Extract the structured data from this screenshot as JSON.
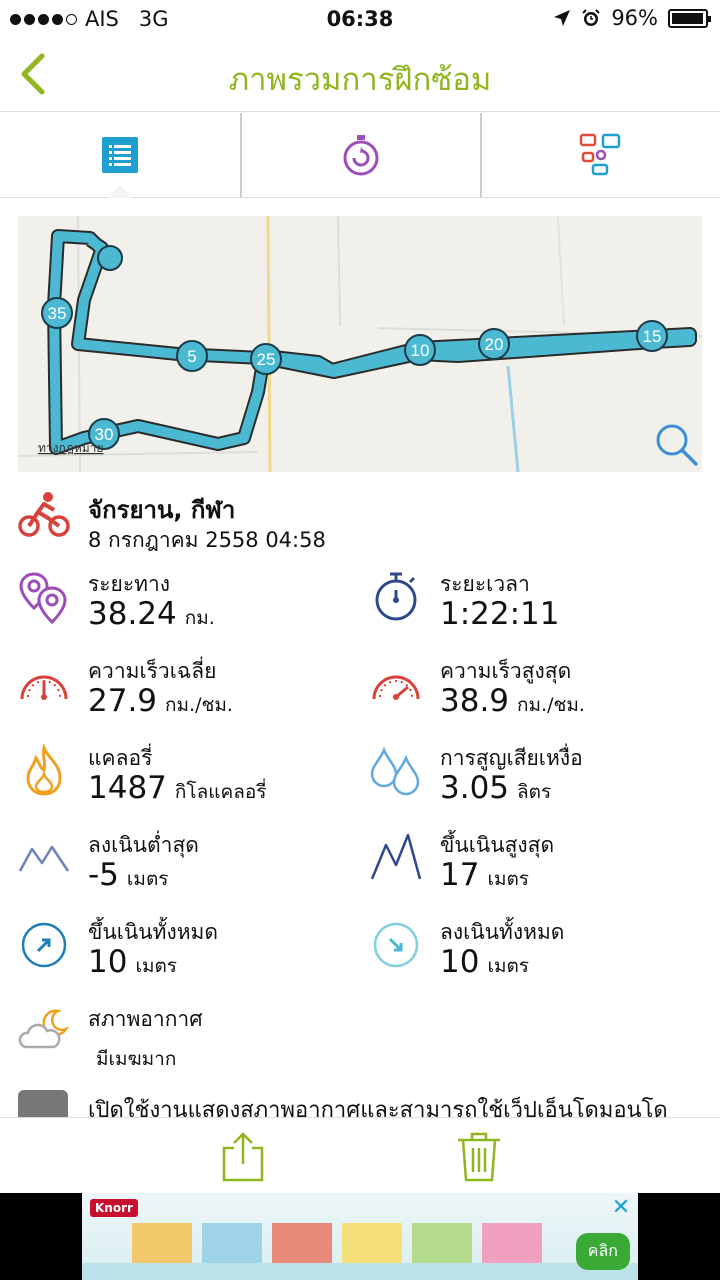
{
  "status_bar": {
    "carrier": "AIS",
    "network": "3G",
    "time": "06:38",
    "battery": "96%"
  },
  "header": {
    "title": "ภาพรวมการฝึกซ้อม"
  },
  "tabs": [
    {
      "name": "summary",
      "icon": "list-icon",
      "active": true
    },
    {
      "name": "laps",
      "icon": "stopwatch-icon",
      "active": false
    },
    {
      "name": "share",
      "icon": "social-icon",
      "active": false
    }
  ],
  "map": {
    "markers": [
      "35",
      "5",
      "25",
      "10",
      "20",
      "15",
      "30"
    ],
    "attribution": "ทางกฎหมาย"
  },
  "activity": {
    "type": "จักรยาน, กีฬา",
    "date": "8 กรกฎาคม 2558 04:58"
  },
  "stats": {
    "distance": {
      "label": "ระยะทาง",
      "value": "38.24",
      "unit": "กม."
    },
    "duration": {
      "label": "ระยะเวลา",
      "value": "1:22:11"
    },
    "avg_speed": {
      "label": "ความเร็วเฉลี่ย",
      "value": "27.9",
      "unit": "กม./ชม."
    },
    "max_speed": {
      "label": "ความเร็วสูงสุด",
      "value": "38.9",
      "unit": "กม./ชม."
    },
    "calories": {
      "label": "แคลอรี่",
      "value": "1487",
      "unit": "กิโลแคลอรี่"
    },
    "sweat_loss": {
      "label": "การสูญเสียเหงื่อ",
      "value": "3.05",
      "unit": "ลิตร"
    },
    "min_altitude": {
      "label": "ลงเนินต่ำสุด",
      "value": "-5",
      "unit": "เมตร"
    },
    "max_altitude": {
      "label": "ขึ้นเนินสูงสุด",
      "value": "17",
      "unit": "เมตร"
    },
    "total_ascent": {
      "label": "ขึ้นเนินทั้งหมด",
      "value": "10",
      "unit": "เมตร"
    },
    "total_descent": {
      "label": "ลงเนินทั้งหมด",
      "value": "10",
      "unit": "เมตร"
    },
    "weather": {
      "label": "สภาพอากาศ",
      "description": "มีเมฆมาก"
    }
  },
  "notice": {
    "text": "เปิดใช้งานแสดงสภาพอากาศและสามารถใช้เว็ปเอ็นโดมอนโด"
  },
  "ad": {
    "brand": "Knorr",
    "cta": "คลิก"
  },
  "colors": {
    "accent_green": "#8fb61e",
    "route_blue": "#4bb9d2",
    "red": "#d9413b",
    "purple": "#9b4db8",
    "navy": "#2f4a8a",
    "orange": "#f0a020",
    "light_blue": "#5fa8e0"
  }
}
